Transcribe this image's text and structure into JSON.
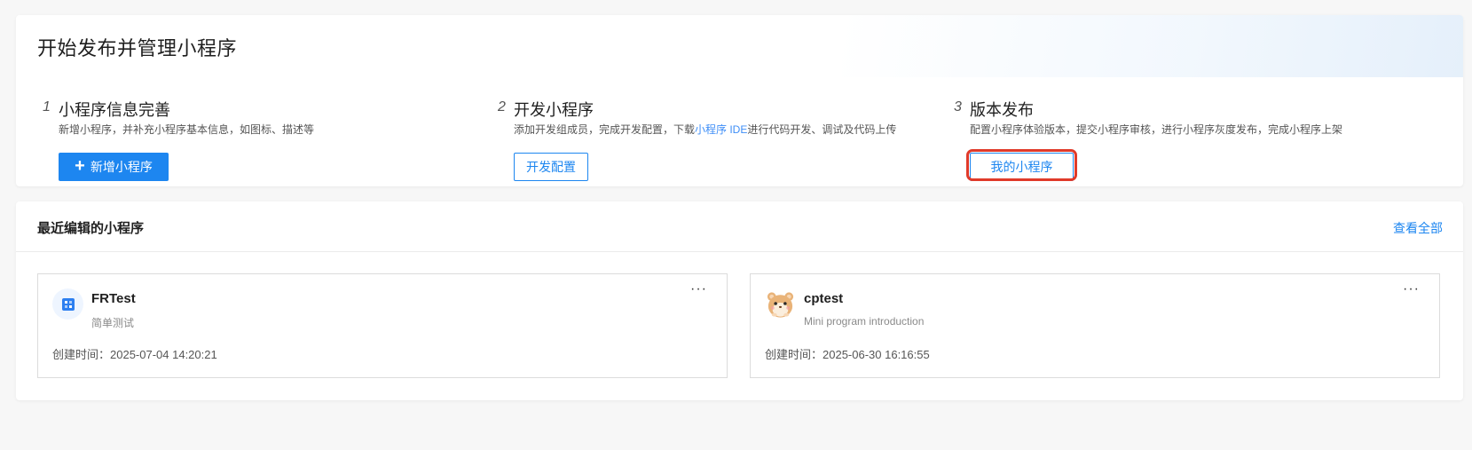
{
  "header": {
    "title": "开始发布并管理小程序"
  },
  "steps": [
    {
      "num": "1",
      "title": "小程序信息完善",
      "desc": "新增小程序，并补充小程序基本信息，如图标、描述等",
      "button": "新增小程序",
      "button_icon": "plus-icon"
    },
    {
      "num": "2",
      "title": "开发小程序",
      "desc_pre": "添加开发组成员，完成开发配置，下载",
      "desc_link": "小程序 IDE",
      "desc_post": "进行代码开发、调试及代码上传",
      "button": "开发配置"
    },
    {
      "num": "3",
      "title": "版本发布",
      "desc": "配置小程序体验版本，提交小程序审核，进行小程序灰度发布，完成小程序上架",
      "button": "我的小程序"
    }
  ],
  "recent": {
    "title": "最近编辑的小程序",
    "view_all": "查看全部",
    "cards": [
      {
        "name": "FRTest",
        "subtitle": "简单测试",
        "created": "创建时间：2025-07-04 14:20:21",
        "more": "···",
        "icon": "app-grid-icon"
      },
      {
        "name": "cptest",
        "subtitle": "Mini program introduction",
        "created": "创建时间：2025-06-30 16:16:55",
        "more": "···",
        "icon": "hamster-avatar-icon"
      }
    ]
  },
  "colors": {
    "accent": "#1d86f0",
    "highlight": "#e03a2a",
    "link": "#3e8ef7"
  }
}
